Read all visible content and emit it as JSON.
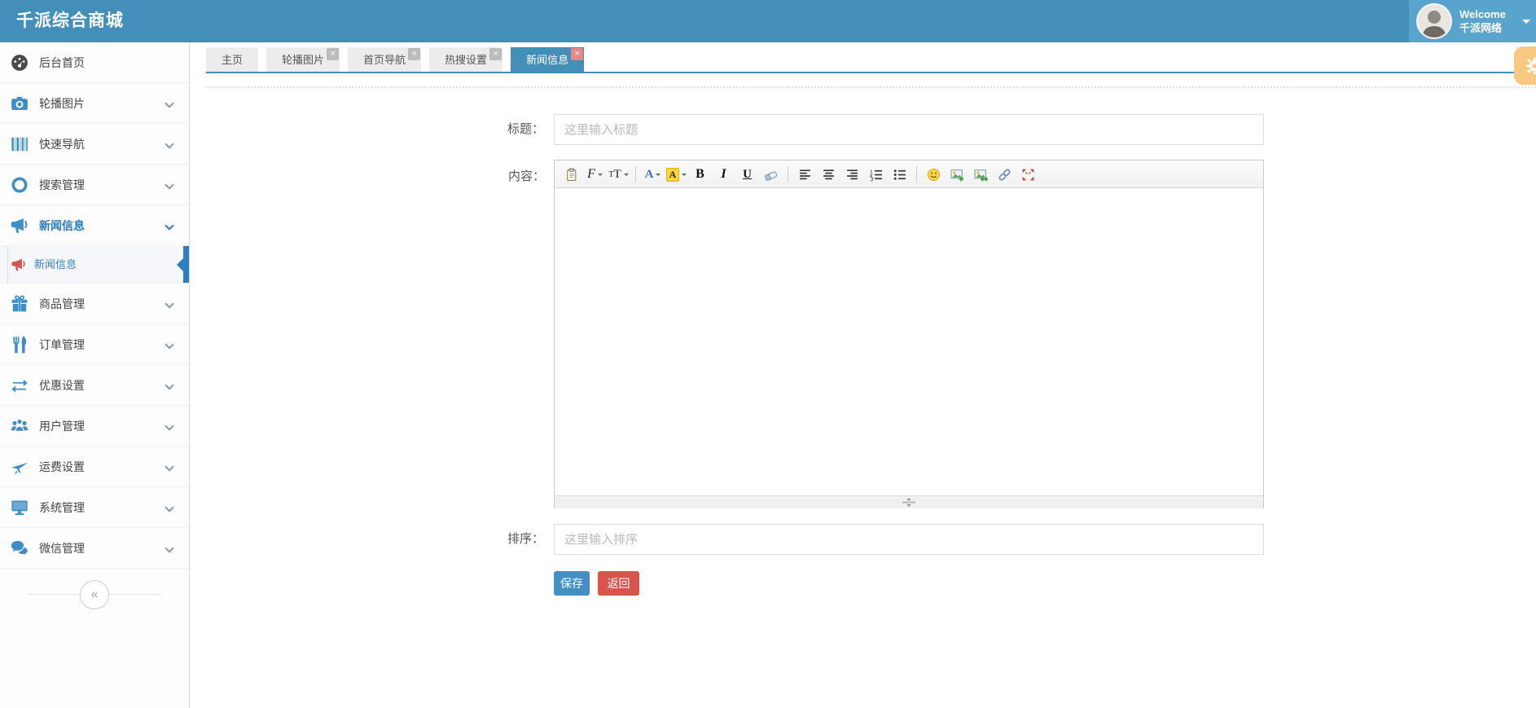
{
  "header": {
    "title": "千派综合商城",
    "welcome_line1": "Welcome",
    "welcome_line2": "千派网络"
  },
  "sidebar": {
    "collapse_glyph": "«",
    "items": [
      {
        "key": "dashboard",
        "label": "后台首页",
        "icon": "dashboard-icon",
        "chevron": false,
        "active": false
      },
      {
        "key": "carousel",
        "label": "轮播图片",
        "icon": "camera-icon",
        "chevron": true,
        "active": false
      },
      {
        "key": "quick-nav",
        "label": "快速导航",
        "icon": "barcode-icon",
        "chevron": true,
        "active": false
      },
      {
        "key": "search",
        "label": "搜索管理",
        "icon": "ring-icon",
        "chevron": true,
        "active": false
      },
      {
        "key": "news",
        "label": "新闻信息",
        "icon": "megaphone-icon",
        "chevron": true,
        "active": true,
        "submenu": [
          {
            "key": "news-sub",
            "label": "新闻信息",
            "icon": "megaphone-icon",
            "active": true
          }
        ]
      },
      {
        "key": "goods",
        "label": "商品管理",
        "icon": "gift-icon",
        "chevron": true,
        "active": false
      },
      {
        "key": "orders",
        "label": "订单管理",
        "icon": "cutlery-icon",
        "chevron": true,
        "active": false
      },
      {
        "key": "discount",
        "label": "优惠设置",
        "icon": "exchange-icon",
        "chevron": true,
        "active": false
      },
      {
        "key": "users",
        "label": "用户管理",
        "icon": "users-icon",
        "chevron": true,
        "active": false
      },
      {
        "key": "shipping",
        "label": "运费设置",
        "icon": "plane-icon",
        "chevron": true,
        "active": false
      },
      {
        "key": "system",
        "label": "系统管理",
        "icon": "desktop-icon",
        "chevron": true,
        "active": false
      },
      {
        "key": "wechat",
        "label": "微信管理",
        "icon": "wechat-icon",
        "chevron": true,
        "active": false
      }
    ]
  },
  "tabs": {
    "close_glyph": "×",
    "items": [
      {
        "key": "home",
        "label": "主页",
        "closable": false,
        "active": false
      },
      {
        "key": "carousel",
        "label": "轮播图片",
        "closable": true,
        "active": false
      },
      {
        "key": "home-nav",
        "label": "首页导航",
        "closable": true,
        "active": false
      },
      {
        "key": "hot-search",
        "label": "热搜设置",
        "closable": true,
        "active": false
      },
      {
        "key": "news",
        "label": "新闻信息",
        "closable": true,
        "active": true
      }
    ]
  },
  "form": {
    "title_label": "标题：",
    "title_placeholder": "这里输入标题",
    "content_label": "内容：",
    "sort_label": "排序：",
    "sort_placeholder": "这里输入排序",
    "save_label": "保存",
    "back_label": "返回"
  },
  "editor": {
    "toolbar": [
      {
        "key": "paste",
        "kind": "svg"
      },
      {
        "key": "fontname",
        "kind": "text",
        "glyph": "F",
        "cls": "g-fontname",
        "caret": true
      },
      {
        "key": "fontsize",
        "kind": "fontsize",
        "glyph_small": "T",
        "glyph_large": "T",
        "caret": true
      },
      {
        "key": "sep1",
        "kind": "sep"
      },
      {
        "key": "forecolor",
        "kind": "text",
        "glyph": "A",
        "cls": "g-forecolor",
        "caret": true
      },
      {
        "key": "hilitecolor",
        "kind": "text",
        "glyph": "A",
        "cls": "g-hilite",
        "caret": true
      },
      {
        "key": "bold",
        "kind": "text",
        "glyph": "B",
        "cls": "g-bold"
      },
      {
        "key": "italic",
        "kind": "text",
        "glyph": "I",
        "cls": "g-italic"
      },
      {
        "key": "underline",
        "kind": "text",
        "glyph": "U",
        "cls": "g-underline"
      },
      {
        "key": "removeformat",
        "kind": "svg"
      },
      {
        "key": "sep2",
        "kind": "sep"
      },
      {
        "key": "justifyleft",
        "kind": "svg"
      },
      {
        "key": "justifycenter",
        "kind": "svg"
      },
      {
        "key": "justifyright",
        "kind": "svg"
      },
      {
        "key": "orderedlist",
        "kind": "svg"
      },
      {
        "key": "unorderedlist",
        "kind": "svg"
      },
      {
        "key": "sep3",
        "kind": "sep"
      },
      {
        "key": "emoticons",
        "kind": "svg"
      },
      {
        "key": "image",
        "kind": "svg"
      },
      {
        "key": "multiimage",
        "kind": "svg"
      },
      {
        "key": "link",
        "kind": "svg"
      },
      {
        "key": "fullscreen",
        "kind": "svg"
      }
    ]
  },
  "colors": {
    "accent_blue": "#448fba",
    "active_blue": "#2a7cbd",
    "icon_blue": "#3e8ec7",
    "danger_red": "#d9534f",
    "orange_tab": "#f8c880"
  }
}
